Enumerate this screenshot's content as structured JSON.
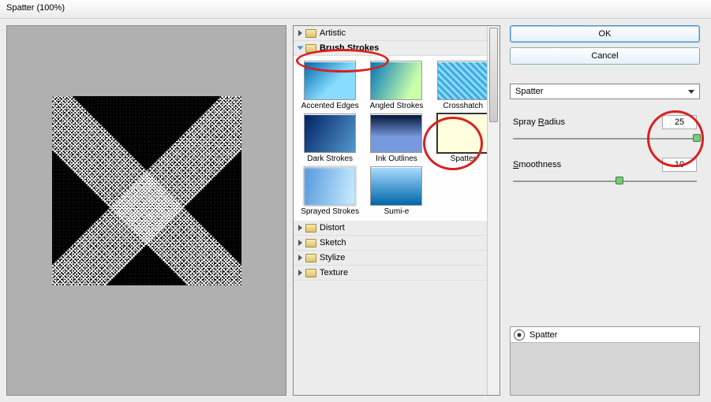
{
  "title": "Spatter (100%)",
  "categories": {
    "artistic": "Artistic",
    "brush_strokes": "Brush Strokes",
    "distort": "Distort",
    "sketch": "Sketch",
    "stylize": "Stylize",
    "texture": "Texture"
  },
  "brush_thumbs": [
    {
      "label": "Accented Edges"
    },
    {
      "label": "Angled Strokes"
    },
    {
      "label": "Crosshatch"
    },
    {
      "label": "Dark Strokes"
    },
    {
      "label": "Ink Outlines"
    },
    {
      "label": "Spatter"
    },
    {
      "label": "Sprayed Strokes"
    },
    {
      "label": "Sumi-e"
    }
  ],
  "buttons": {
    "ok": "OK",
    "cancel": "Cancel"
  },
  "dropdown": {
    "selected": "Spatter"
  },
  "params": {
    "spray_radius": {
      "label_pre": "Spray ",
      "label_u": "R",
      "label_post": "adius",
      "value": "25"
    },
    "smoothness": {
      "label_pre": "",
      "label_u": "S",
      "label_post": "moothness",
      "value": "10"
    }
  },
  "history": {
    "item": "Spatter"
  }
}
